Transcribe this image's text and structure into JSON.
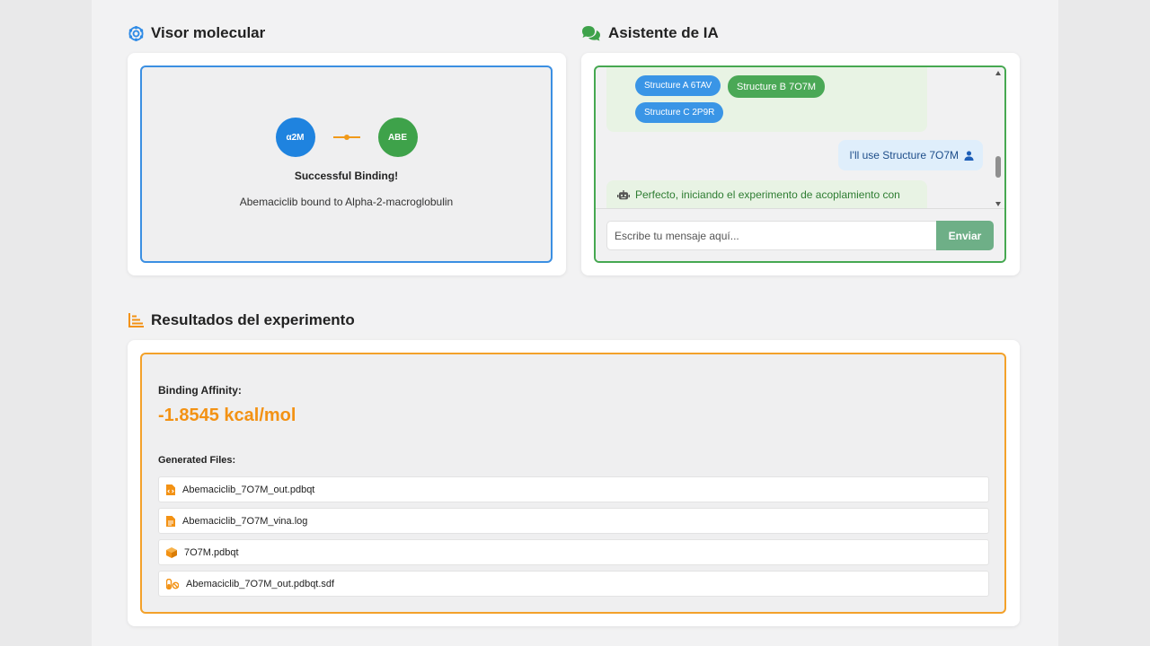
{
  "viewer": {
    "title": "Visor molecular",
    "mol_a": "α2M",
    "mol_b": "ABE",
    "status": "Successful Binding!",
    "description": "Abemaciclib bound to Alpha-2-macroglobulin"
  },
  "assistant": {
    "title": "Asistente de IA",
    "structures": [
      {
        "label": "Structure A 6TAV"
      },
      {
        "label": "Structure B 7O7M"
      },
      {
        "label": "Structure C 2P9R"
      }
    ],
    "user_message": "I'll use Structure 7O7M",
    "bot_message": "Perfecto, iniciando el experimento de acoplamiento con",
    "input_placeholder": "Escribe tu mensaje aquí...",
    "send_label": "Enviar"
  },
  "results": {
    "title": "Resultados del experimento",
    "affinity_label": "Binding Affinity:",
    "affinity_value": "-1.8545 kcal/mol",
    "files_label": "Generated Files:",
    "files": [
      {
        "name": "Abemaciclib_7O7M_out.pdbqt",
        "icon": "file-code-icon"
      },
      {
        "name": "Abemaciclib_7O7M_vina.log",
        "icon": "file-text-icon"
      },
      {
        "name": "7O7M.pdbqt",
        "icon": "cube-icon"
      },
      {
        "name": "Abemaciclib_7O7M_out.pdbqt.sdf",
        "icon": "pills-icon"
      }
    ]
  },
  "colors": {
    "blue": "#1f83df",
    "green": "#3ea24a",
    "orange": "#f39214"
  }
}
